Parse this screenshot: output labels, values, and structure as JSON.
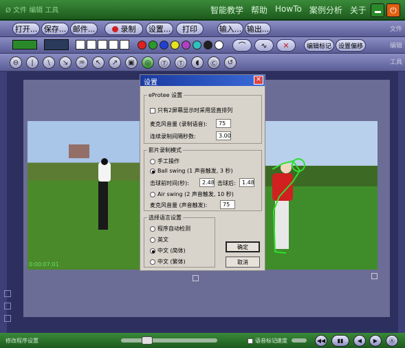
{
  "titlebar": {
    "logo": "Ø 文件 编辑 工具",
    "menu": [
      "智能教学",
      "帮助",
      "HowTo",
      "案例分析",
      "关于"
    ]
  },
  "toolbar1": {
    "buttons": [
      "打开...",
      "保存...",
      "邮件...",
      "录制",
      "设置...",
      "打印",
      "输入...",
      "输出..."
    ],
    "tag": "文件"
  },
  "toolbar2": {
    "colors": [
      "#e02020",
      "#2a9a2a",
      "#2040d0",
      "#e6e020",
      "#b040c0",
      "#30c0c0",
      "#202020",
      "#ffffff"
    ],
    "edit_mark_label": "编辑标记",
    "offset_label": "设置偏移",
    "tag": "编辑"
  },
  "toolbar3": {
    "icons": [
      "⊖",
      "|",
      "\\",
      "↘",
      "♒",
      "↖",
      "↗",
      "▣",
      "◎",
      "Ⓣ",
      "Ⓣ",
      "◖",
      "Ⓒ",
      "↺"
    ],
    "tag": "工具"
  },
  "video_left": {
    "timestamp": "0:00:07:01"
  },
  "dialog": {
    "title": "设置",
    "group1_title": "eProtee 设置",
    "dual_screen_label": "只有2屏幕显示时采用竖直排列",
    "mic_volume_label": "麦克风音量 (录制语音):",
    "mic_volume_value": "75",
    "auto_interval_label": "连续录制间隔秒数:",
    "auto_interval_value": "3.00",
    "group2_title": "影片录制模式",
    "manual_label": "手工操作",
    "ball_swing_label": "Ball swing (1 声音触发, 3 秒)",
    "pre_time_label": "击球前时间(秒):",
    "pre_time_value": "2.48",
    "post_label": "击球后:",
    "post_value": "1.48",
    "air_swing_label": "Air swing (2 声音触发, 10 秒)",
    "mic_volume2_label": "麦克风音量 (声音触发):",
    "mic_volume2_value": "75",
    "group3_title": "选择语言设置",
    "auto_detect_label": "程序自动检测",
    "english_label": "英文",
    "chinese_simplified_label": "中文 (简体)",
    "chinese_traditional_label": "中文 (繁体)",
    "ok_label": "确定",
    "cancel_label": "取消"
  },
  "statusbar": {
    "status_text": "修改程序设置",
    "voice_label": "语音标记",
    "speed_label": "速度",
    "playback": [
      "◀◀",
      "▮▮",
      "◀",
      "▶",
      "Ⓐ"
    ]
  }
}
